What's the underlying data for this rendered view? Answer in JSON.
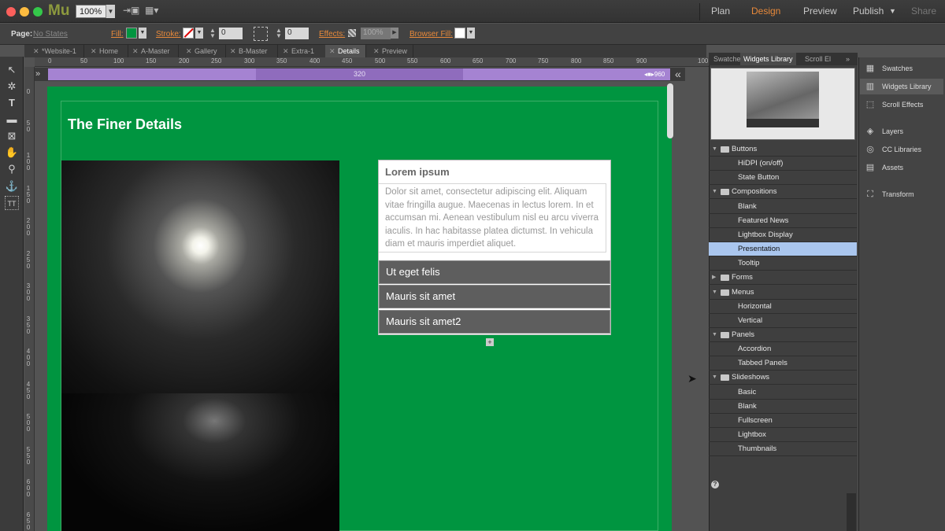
{
  "app": {
    "logo": "Mu",
    "zoom": "100%"
  },
  "modes": {
    "plan": "Plan",
    "design": "Design",
    "preview": "Preview",
    "publish": "Publish",
    "share": "Share"
  },
  "controls": {
    "page_label": "Page:",
    "page_state": "No States",
    "fill": "Fill:",
    "stroke": "Stroke:",
    "stroke_val": "0",
    "corner_val": "0",
    "effects": "Effects:",
    "effects_val": "100%",
    "browser_fill": "Browser Fill:"
  },
  "tabs": [
    "*Website-1",
    "Home",
    "A-Master",
    "Gallery",
    "B-Master",
    "Extra-1",
    "Details",
    "Preview"
  ],
  "ruler": [
    "0",
    "50",
    "100",
    "150",
    "200",
    "250",
    "300",
    "350",
    "400",
    "450",
    "500",
    "550",
    "600",
    "650",
    "700",
    "750",
    "800",
    "850",
    "900",
    "100"
  ],
  "vruler": [
    "0",
    "50",
    "100",
    "150",
    "200",
    "250",
    "300",
    "350",
    "400",
    "450",
    "500",
    "550",
    "600",
    "650"
  ],
  "breakpoints": {
    "mid": "320",
    "end": "960"
  },
  "canvas": {
    "heading": "The Finer Details",
    "accordion": {
      "title": "Lorem ipsum",
      "body": "Dolor sit amet, consectetur adipiscing elit. Aliquam vitae fringilla augue. Maecenas in lectus lorem. In et accumsan mi. Aenean vestibulum nisl eu arcu viverra iaculis. In hac habitasse platea dictumst. In vehicula diam et mauris imperdiet aliquet.",
      "rows": [
        "Ut eget felis",
        "Mauris sit amet",
        "Mauris sit amet2"
      ]
    }
  },
  "panel": {
    "tabs": [
      "Swatche",
      "Widgets Library",
      "Scroll El"
    ],
    "tree": [
      {
        "label": "Buttons",
        "type": "folder",
        "open": true
      },
      {
        "label": "HiDPI (on/off)",
        "type": "item"
      },
      {
        "label": "State Button",
        "type": "item"
      },
      {
        "label": "Compositions",
        "type": "folder",
        "open": true
      },
      {
        "label": "Blank",
        "type": "item"
      },
      {
        "label": "Featured News",
        "type": "item"
      },
      {
        "label": "Lightbox Display",
        "type": "item"
      },
      {
        "label": "Presentation",
        "type": "item",
        "selected": true
      },
      {
        "label": "Tooltip",
        "type": "item"
      },
      {
        "label": "Forms",
        "type": "folder",
        "open": false
      },
      {
        "label": "Menus",
        "type": "folder",
        "open": true
      },
      {
        "label": "Horizontal",
        "type": "item"
      },
      {
        "label": "Vertical",
        "type": "item"
      },
      {
        "label": "Panels",
        "type": "folder",
        "open": true
      },
      {
        "label": "Accordion",
        "type": "item"
      },
      {
        "label": "Tabbed Panels",
        "type": "item"
      },
      {
        "label": "Slideshows",
        "type": "folder",
        "open": true
      },
      {
        "label": "Basic",
        "type": "item"
      },
      {
        "label": "Blank",
        "type": "item"
      },
      {
        "label": "Fullscreen",
        "type": "item"
      },
      {
        "label": "Lightbox",
        "type": "item"
      },
      {
        "label": "Thumbnails",
        "type": "item"
      }
    ],
    "help": "?"
  },
  "side_panels": [
    {
      "label": "Swatches",
      "icon": "swatches-icon"
    },
    {
      "label": "Widgets Library",
      "icon": "widgets-icon",
      "active": true
    },
    {
      "label": "Scroll Effects",
      "icon": "scroll-effects-icon"
    },
    {
      "label": "Layers",
      "icon": "layers-icon"
    },
    {
      "label": "CC Libraries",
      "icon": "cc-libraries-icon"
    },
    {
      "label": "Assets",
      "icon": "assets-icon"
    },
    {
      "label": "Transform",
      "icon": "transform-icon"
    }
  ],
  "colors": {
    "page_bg": "#009540",
    "fill": "#009540",
    "selected": "#aac6ee",
    "breakpoint": "#a583d2",
    "design_mode": "#e8893a"
  }
}
